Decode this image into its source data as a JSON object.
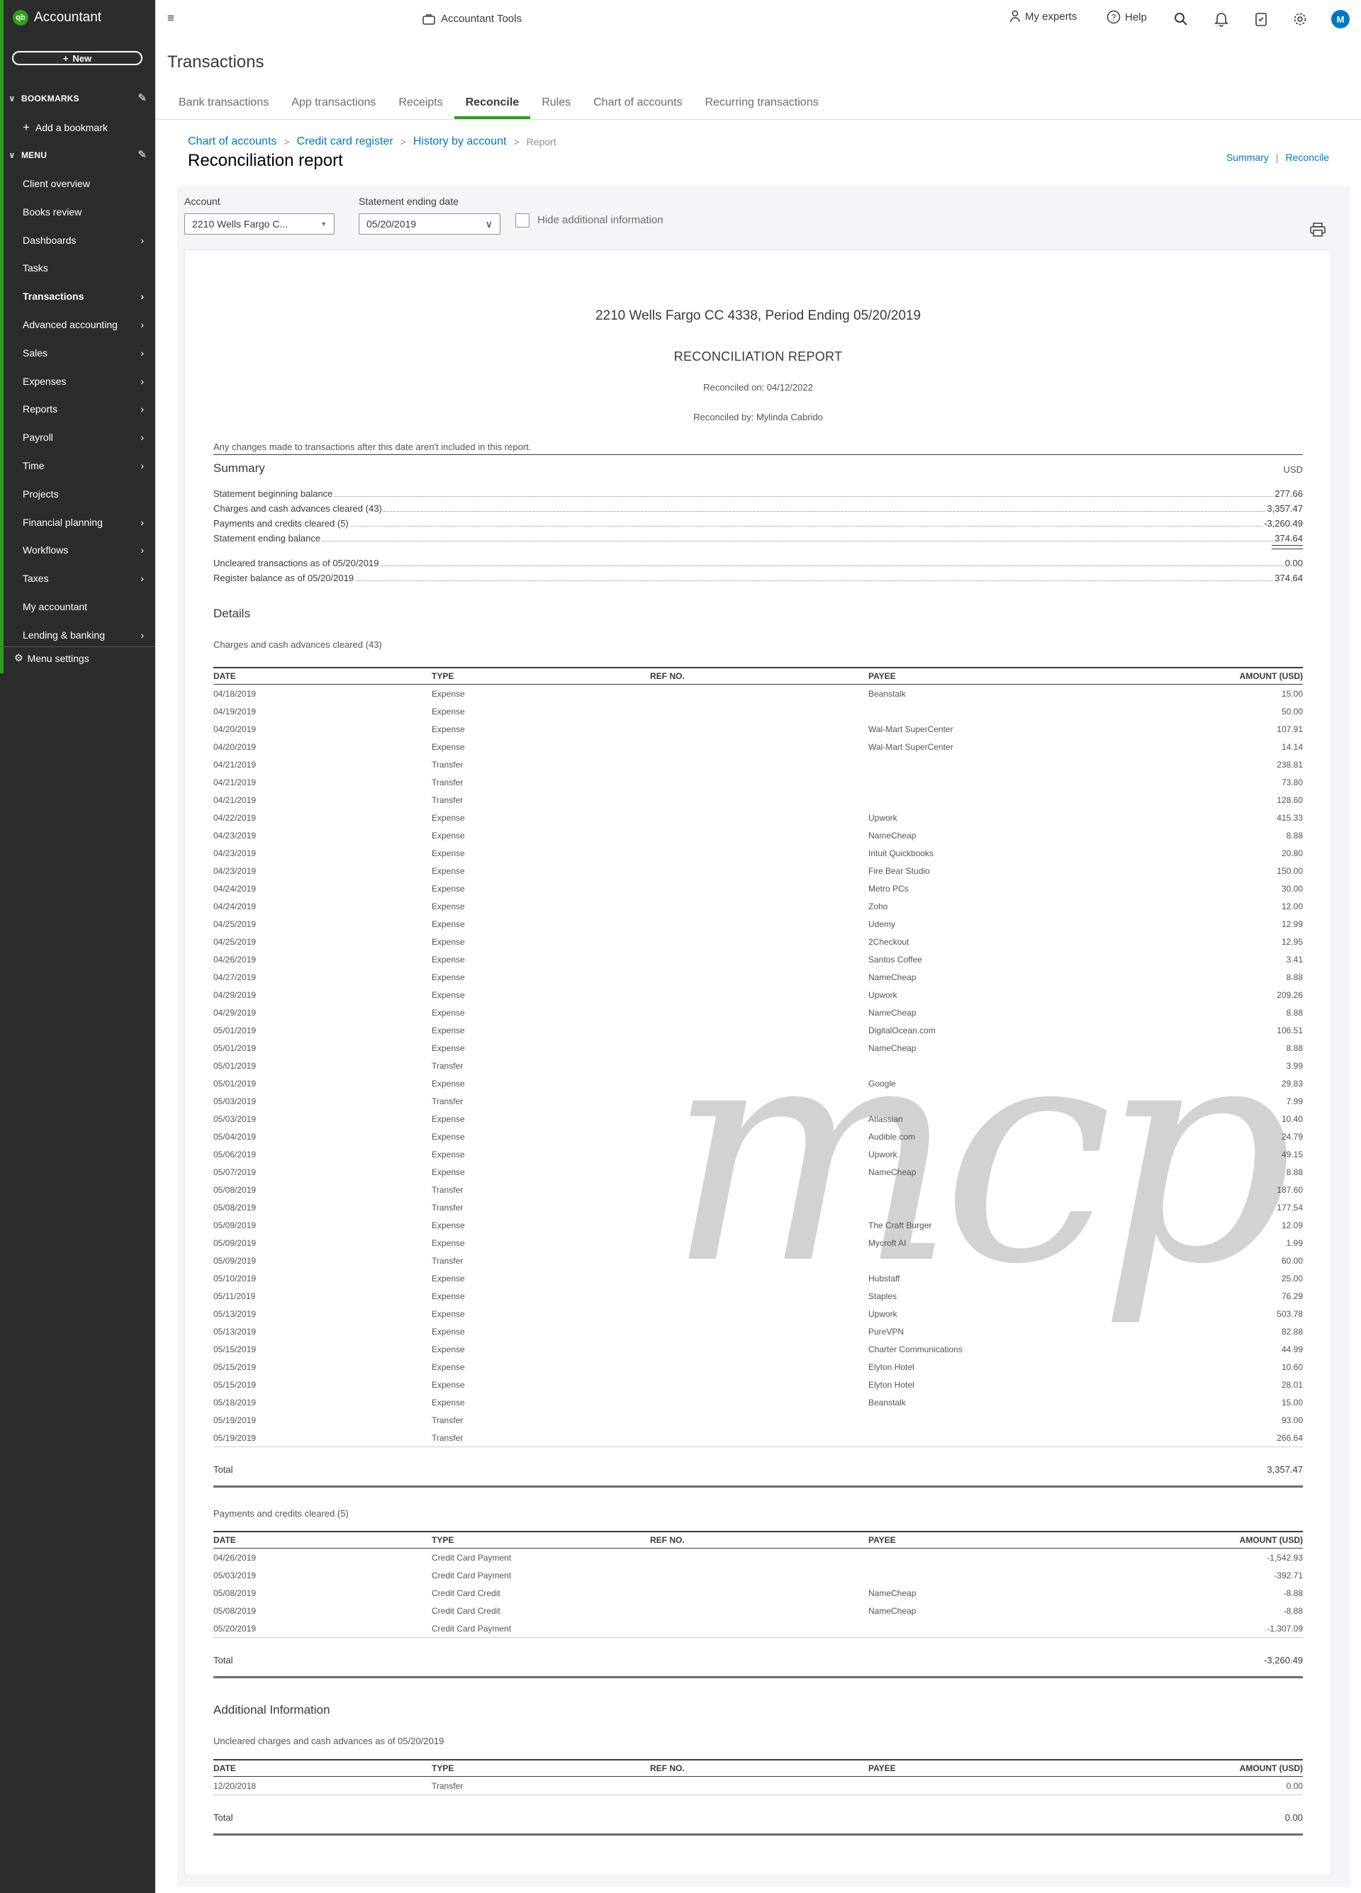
{
  "sidebar": {
    "brand": "Accountant",
    "new_label": "New",
    "bookmarks_label": "BOOKMARKS",
    "add_bookmark": "Add a bookmark",
    "menu_label": "MENU",
    "items": [
      {
        "label": "Client overview",
        "arrow": false
      },
      {
        "label": "Books review",
        "arrow": false
      },
      {
        "label": "Dashboards",
        "arrow": true
      },
      {
        "label": "Tasks",
        "arrow": false
      },
      {
        "label": "Transactions",
        "arrow": true,
        "active": true
      },
      {
        "label": "Advanced accounting",
        "arrow": true
      },
      {
        "label": "Sales",
        "arrow": true
      },
      {
        "label": "Expenses",
        "arrow": true
      },
      {
        "label": "Reports",
        "arrow": true
      },
      {
        "label": "Payroll",
        "arrow": true
      },
      {
        "label": "Time",
        "arrow": true
      },
      {
        "label": "Projects",
        "arrow": false
      },
      {
        "label": "Financial planning",
        "arrow": true
      },
      {
        "label": "Workflows",
        "arrow": true
      },
      {
        "label": "Taxes",
        "arrow": true
      },
      {
        "label": "My accountant",
        "arrow": false
      },
      {
        "label": "Lending & banking",
        "arrow": true
      }
    ],
    "menu_settings": "Menu settings"
  },
  "topbar": {
    "accountant_tools": "Accountant Tools",
    "my_experts": "My experts",
    "help": "Help",
    "avatar_initial": "M"
  },
  "page": {
    "title": "Transactions",
    "tabs": [
      "Bank transactions",
      "App transactions",
      "Receipts",
      "Reconcile",
      "Rules",
      "Chart of accounts",
      "Recurring transactions"
    ],
    "active_tab": "Reconcile"
  },
  "breadcrumb": {
    "chart_of_accounts": "Chart of accounts",
    "credit_card_register": "Credit card register",
    "history_by_account": "History by account",
    "current": "Report",
    "sep": ">"
  },
  "report_header": {
    "title": "Reconciliation report",
    "link_summary": "Summary",
    "link_reconcile": "Reconcile"
  },
  "filters": {
    "account_label": "Account",
    "account_value": "2210 Wells Fargo C...",
    "date_label": "Statement ending date",
    "date_value": "05/20/2019",
    "hide_label": "Hide additional information"
  },
  "report": {
    "subtitle": "2210 Wells Fargo CC 4338, Period Ending 05/20/2019",
    "heading": "RECONCILIATION REPORT",
    "reconciled_on": "Reconciled on: 04/12/2022",
    "reconciled_by": "Reconciled by: Mylinda Cabrido",
    "note": "Any changes made to transactions after this date aren't included in this report.",
    "summary_title": "Summary",
    "currency": "USD",
    "summary": [
      {
        "label": "Statement beginning balance",
        "value": "277.66"
      },
      {
        "label": "Charges and cash advances cleared (43)",
        "value": "3,357.47"
      },
      {
        "label": "Payments and credits cleared (5)",
        "value": "-3,260.49"
      },
      {
        "label": "Statement ending balance",
        "value": "374.64"
      }
    ],
    "summary2": [
      {
        "label": "Uncleared transactions as of 05/20/2019",
        "value": "0.00"
      },
      {
        "label": "Register balance as of 05/20/2019",
        "value": "374.64"
      }
    ],
    "details_title": "Details",
    "columns": [
      "DATE",
      "TYPE",
      "REF NO.",
      "PAYEE",
      "AMOUNT (USD)"
    ],
    "total_label": "Total",
    "charges_caption": "Charges and cash advances cleared (43)",
    "charges": [
      [
        "04/18/2019",
        "Expense",
        "",
        "Beanstalk",
        "15.00"
      ],
      [
        "04/19/2019",
        "Expense",
        "",
        "",
        "50.00"
      ],
      [
        "04/20/2019",
        "Expense",
        "",
        "Wal-Mart SuperCenter",
        "107.91"
      ],
      [
        "04/20/2019",
        "Expense",
        "",
        "Wal-Mart SuperCenter",
        "14.14"
      ],
      [
        "04/21/2019",
        "Transfer",
        "",
        "",
        "238.81"
      ],
      [
        "04/21/2019",
        "Transfer",
        "",
        "",
        "73.80"
      ],
      [
        "04/21/2019",
        "Transfer",
        "",
        "",
        "128.60"
      ],
      [
        "04/22/2019",
        "Expense",
        "",
        "Upwork",
        "415.33"
      ],
      [
        "04/23/2019",
        "Expense",
        "",
        "NameCheap",
        "8.88"
      ],
      [
        "04/23/2019",
        "Expense",
        "",
        "Intuit Quickbooks",
        "20.80"
      ],
      [
        "04/23/2019",
        "Expense",
        "",
        "Fire Bear Studio",
        "150.00"
      ],
      [
        "04/24/2019",
        "Expense",
        "",
        "Metro PCs",
        "30.00"
      ],
      [
        "04/24/2019",
        "Expense",
        "",
        "Zoho",
        "12.00"
      ],
      [
        "04/25/2019",
        "Expense",
        "",
        "Udemy",
        "12.99"
      ],
      [
        "04/25/2019",
        "Expense",
        "",
        "2Checkout",
        "12.95"
      ],
      [
        "04/26/2019",
        "Expense",
        "",
        "Santos Coffee",
        "3.41"
      ],
      [
        "04/27/2019",
        "Expense",
        "",
        "NameCheap",
        "8.88"
      ],
      [
        "04/29/2019",
        "Expense",
        "",
        "Upwork",
        "209.26"
      ],
      [
        "04/29/2019",
        "Expense",
        "",
        "NameCheap",
        "8.88"
      ],
      [
        "05/01/2019",
        "Expense",
        "",
        "DigitalOcean.com",
        "106.51"
      ],
      [
        "05/01/2019",
        "Expense",
        "",
        "NameCheap",
        "8.88"
      ],
      [
        "05/01/2019",
        "Transfer",
        "",
        "",
        "3.99"
      ],
      [
        "05/01/2019",
        "Expense",
        "",
        "Google",
        "29.83"
      ],
      [
        "05/03/2019",
        "Transfer",
        "",
        "",
        "7.99"
      ],
      [
        "05/03/2019",
        "Expense",
        "",
        "Atlassian",
        "10.40"
      ],
      [
        "05/04/2019",
        "Expense",
        "",
        "Audible.com",
        "24.79"
      ],
      [
        "05/06/2019",
        "Expense",
        "",
        "Upwork",
        "49.15"
      ],
      [
        "05/07/2019",
        "Expense",
        "",
        "NameCheap",
        "8.88"
      ],
      [
        "05/08/2019",
        "Transfer",
        "",
        "",
        "187.60"
      ],
      [
        "05/08/2019",
        "Transfer",
        "",
        "",
        "177.54"
      ],
      [
        "05/09/2019",
        "Expense",
        "",
        "The Craft Burger",
        "12.09"
      ],
      [
        "05/09/2019",
        "Expense",
        "",
        "Mycroft AI",
        "1.99"
      ],
      [
        "05/09/2019",
        "Transfer",
        "",
        "",
        "60.00"
      ],
      [
        "05/10/2019",
        "Expense",
        "",
        "Hubstaff",
        "25.00"
      ],
      [
        "05/11/2019",
        "Expense",
        "",
        "Staples",
        "76.29"
      ],
      [
        "05/13/2019",
        "Expense",
        "",
        "Upwork",
        "503.78"
      ],
      [
        "05/13/2019",
        "Expense",
        "",
        "PureVPN",
        "82.88"
      ],
      [
        "05/15/2019",
        "Expense",
        "",
        "Charter Communications",
        "44.99"
      ],
      [
        "05/15/2019",
        "Expense",
        "",
        "Elyton Hotel",
        "10.60"
      ],
      [
        "05/15/2019",
        "Expense",
        "",
        "Elyton Hotel",
        "28.01"
      ],
      [
        "05/18/2019",
        "Expense",
        "",
        "Beanstalk",
        "15.00"
      ],
      [
        "05/19/2019",
        "Transfer",
        "",
        "",
        "93.00"
      ],
      [
        "05/19/2019",
        "Transfer",
        "",
        "",
        "266.64"
      ]
    ],
    "charges_total": "3,357.47",
    "payments_caption": "Payments and credits cleared (5)",
    "payments": [
      [
        "04/26/2019",
        "Credit Card Payment",
        "",
        "",
        "-1,542.93"
      ],
      [
        "05/03/2019",
        "Credit Card Payment",
        "",
        "",
        "-392.71"
      ],
      [
        "05/08/2019",
        "Credit Card Credit",
        "",
        "NameCheap",
        "-8.88"
      ],
      [
        "05/08/2019",
        "Credit Card Credit",
        "",
        "NameCheap",
        "-8.88"
      ],
      [
        "05/20/2019",
        "Credit Card Payment",
        "",
        "",
        "-1,307.09"
      ]
    ],
    "payments_total": "-3,260.49",
    "additional_title": "Additional Information",
    "uncleared_caption": "Uncleared charges and cash advances as of 05/20/2019",
    "uncleared": [
      [
        "12/20/2018",
        "Transfer",
        "",
        "",
        "0.00"
      ]
    ],
    "uncleared_total": "0.00",
    "watermark": "mcp"
  },
  "colors": {
    "brand_green": "#2ca01c",
    "link_blue": "#0077c5",
    "sidebar_bg": "#2c2c2c"
  }
}
